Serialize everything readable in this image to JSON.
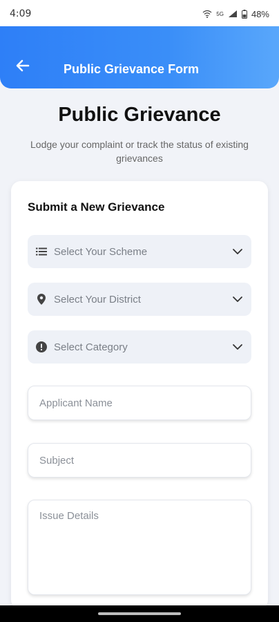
{
  "status_bar": {
    "time": "4:09",
    "battery": "48%",
    "network": "5G"
  },
  "header": {
    "title": "Public Grievance Form",
    "back_icon": "arrow-left-icon"
  },
  "page": {
    "title": "Public Grievance",
    "subtitle": "Lodge your complaint or track the status of existing grievances"
  },
  "form": {
    "title": "Submit a New Grievance",
    "selects": [
      {
        "label": "Select Your Scheme",
        "icon": "list-icon"
      },
      {
        "label": "Select Your District",
        "icon": "location-pin-icon"
      },
      {
        "label": "Select Category",
        "icon": "alert-circle-icon"
      }
    ],
    "applicant_name": {
      "placeholder": "Applicant Name",
      "value": ""
    },
    "subject": {
      "placeholder": "Subject",
      "value": ""
    },
    "issue_details": {
      "placeholder": "Issue Details",
      "value": ""
    }
  },
  "colors": {
    "header_gradient_start": "#2e7ff7",
    "header_gradient_end": "#59a7fb",
    "background": "#f1f3f8"
  }
}
